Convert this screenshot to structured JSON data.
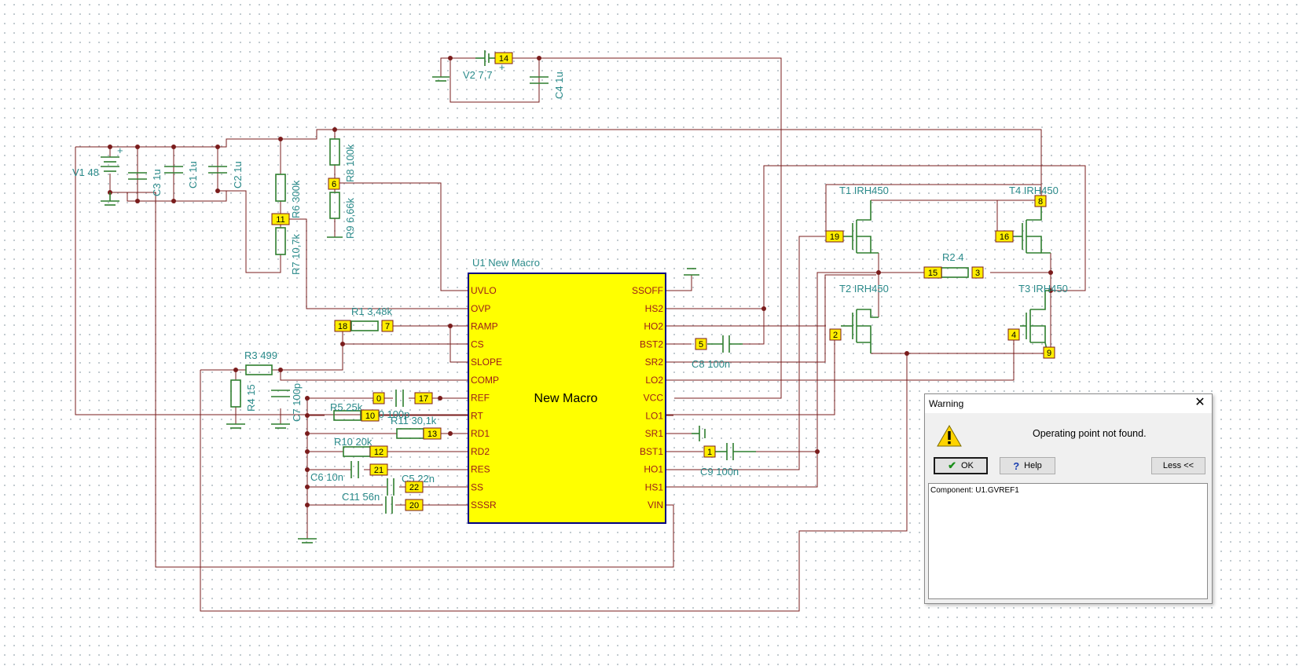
{
  "schematic": {
    "labels": {
      "v2": "V2 7,7",
      "c4": "C4 1u",
      "v1": "V1 48",
      "c3": "C3 1u",
      "c1": "C1 1u",
      "c2": "C2 1u",
      "r6": "R6 300k",
      "r7": "R7 10,7k",
      "r8": "R8 100k",
      "r9": "R9 6,66k",
      "u1": "U1 New Macro",
      "r1": "R1 3,48k",
      "r3": "R3 499",
      "r4": "R4 15",
      "c7": "C7 100p",
      "r5": "R5 25k",
      "c10": "C10 100p",
      "r11": "R11 30,1k",
      "r10": "R10 20k",
      "c6": "C6 10n",
      "c5": "C5 22n",
      "c11": "C11 56n",
      "c8": "C8 100n",
      "c9": "C9 100n",
      "t1": "T1 IRH450",
      "t4": "T4 IRH450",
      "t2": "T2 IRH450",
      "t3": "T3 IRH450",
      "r2": "R2 4",
      "plus": "+"
    },
    "macro": {
      "name": "New Macro",
      "left_pins": [
        "UVLO",
        "OVP",
        "RAMP",
        "CS",
        "SLOPE",
        "COMP",
        "REF",
        "RT",
        "RD1",
        "RD2",
        "RES",
        "SS",
        "SSSR"
      ],
      "right_pins": [
        "SSOFF",
        "HS2",
        "HO2",
        "BST2",
        "SR2",
        "LO2",
        "VCC",
        "LO1",
        "SR1",
        "BST1",
        "HO1",
        "HS1",
        "VIN"
      ]
    },
    "nodes": {
      "n14": "14",
      "n6": "6",
      "n11": "11",
      "n18": "18",
      "n7": "7",
      "n0": "0",
      "n17": "17",
      "n10": "10",
      "n13": "13",
      "n12": "12",
      "n21": "21",
      "n22": "22",
      "n20": "20",
      "n5": "5",
      "n1": "1",
      "n19": "19",
      "n16": "16",
      "n8": "8",
      "n15": "15",
      "n3": "3",
      "n2": "2",
      "n4": "4",
      "n9": "9"
    }
  },
  "dialog": {
    "title": "Warning",
    "close_glyph": "✕",
    "message": "Operating point not found.",
    "ok_label": "OK",
    "ok_glyph": "✔",
    "help_label": "Help",
    "help_glyph": "?",
    "less_label": "Less <<",
    "details": "Component: U1.GVREF1",
    "icon": "warning-icon",
    "colors": {
      "ok_check": "#1a8f1a",
      "help_q": "#1a3fb0",
      "warn": "#ffd400"
    }
  }
}
